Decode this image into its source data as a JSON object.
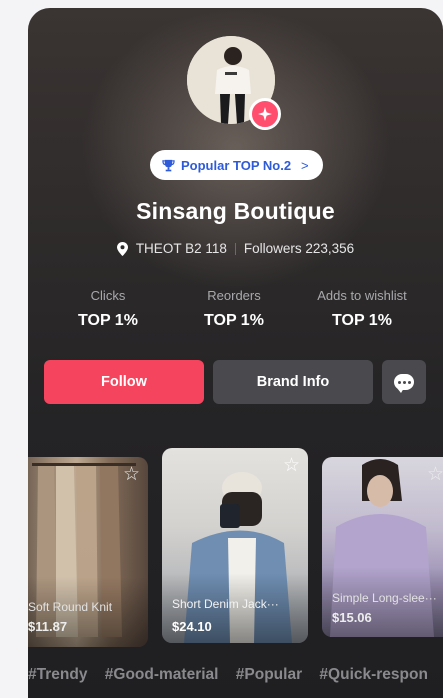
{
  "shop": {
    "rank_label": "Popular TOP No.2",
    "name": "Sinsang Boutique",
    "location": "THEOT B2 118",
    "followers": "Followers 223,356"
  },
  "stats": [
    {
      "label": "Clicks",
      "value": "TOP 1%"
    },
    {
      "label": "Reorders",
      "value": "TOP 1%"
    },
    {
      "label": "Adds to wishlist",
      "value": "TOP 1%"
    }
  ],
  "actions": {
    "follow_label": "Follow",
    "brand_info_label": "Brand Info",
    "chat_icon": "chat-bubble-icon"
  },
  "products": [
    {
      "name": "Soft Round Knit",
      "price": "$11.87"
    },
    {
      "name": "Short Denim Jack···",
      "price": "$24.10"
    },
    {
      "name": "Simple Long-slee···",
      "price": "$15.06"
    }
  ],
  "tags": [
    "#Trendy",
    "#Good-material",
    "#Popular",
    "#Quick-respon"
  ],
  "colors": {
    "accent": "#f5445d",
    "rank_text": "#2f5bd9",
    "badge": "#ff4e6e"
  }
}
